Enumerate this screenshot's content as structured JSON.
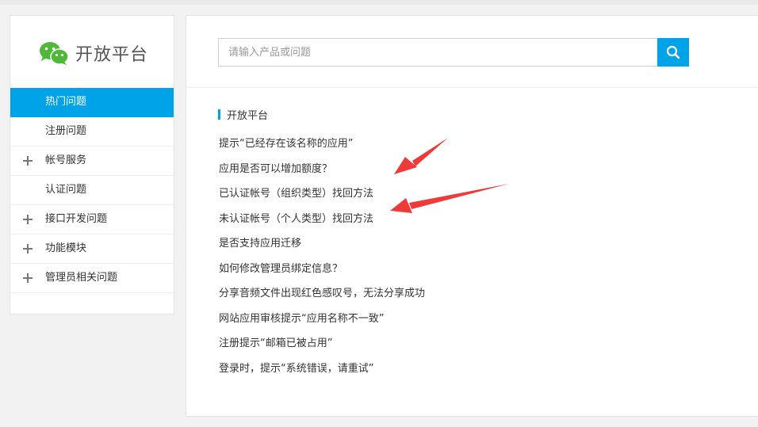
{
  "brand": {
    "name": "开放平台"
  },
  "sidebar": {
    "items": [
      {
        "label": "热门问题",
        "active": true,
        "expandable": false
      },
      {
        "label": "注册问题",
        "active": false,
        "expandable": false
      },
      {
        "label": "帐号服务",
        "active": false,
        "expandable": true
      },
      {
        "label": "认证问题",
        "active": false,
        "expandable": false
      },
      {
        "label": "接口开发问题",
        "active": false,
        "expandable": true
      },
      {
        "label": "功能模块",
        "active": false,
        "expandable": true
      },
      {
        "label": "管理员相关问题",
        "active": false,
        "expandable": true
      }
    ]
  },
  "search": {
    "placeholder": "请输入产品或问题",
    "value": "",
    "icon": "search-icon"
  },
  "section": {
    "title": "开放平台"
  },
  "questions": [
    "提示“已经存在该名称的应用”",
    "应用是否可以增加额度？",
    "已认证帐号（组织类型）找回方法",
    "未认证帐号（个人类型）找回方法",
    "是否支持应用迁移",
    "如何修改管理员绑定信息？",
    "分享音频文件出现红色感叹号，无法分享成功",
    "网站应用审核提示“应用名称不一致”",
    "注册提示“邮箱已被占用”",
    "登录时，提示“系统错误，请重试”"
  ],
  "colors": {
    "accent": "#00a2e8",
    "brand_green": "#4fb838",
    "annotation_red": "#ef3a3a"
  }
}
